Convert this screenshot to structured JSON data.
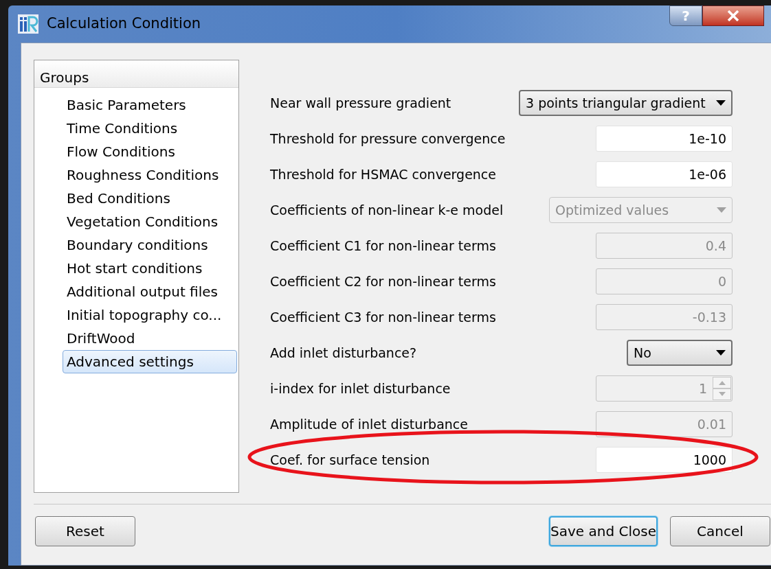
{
  "window": {
    "title": "Calculation Condition",
    "help": "?"
  },
  "groups": {
    "header": "Groups",
    "items": [
      {
        "label": "Basic Parameters",
        "selected": false
      },
      {
        "label": "Time Conditions",
        "selected": false
      },
      {
        "label": "Flow Conditions",
        "selected": false
      },
      {
        "label": "Roughness Conditions",
        "selected": false
      },
      {
        "label": "Bed Conditions",
        "selected": false
      },
      {
        "label": "Vegetation Conditions",
        "selected": false
      },
      {
        "label": "Boundary conditions",
        "selected": false
      },
      {
        "label": "Hot start conditions",
        "selected": false
      },
      {
        "label": "Additional output files",
        "selected": false
      },
      {
        "label": "Initial topography co...",
        "selected": false
      },
      {
        "label": "DriftWood",
        "selected": false
      },
      {
        "label": "Advanced settings",
        "selected": true
      }
    ]
  },
  "settings": [
    {
      "label": "Near wall pressure gradient",
      "kind": "combo",
      "value": "3 points triangular gradient",
      "disabled": false
    },
    {
      "label": "Threshold for pressure convergence",
      "kind": "input",
      "value": "1e-10",
      "disabled": false
    },
    {
      "label": "Threshold for HSMAC convergence",
      "kind": "input",
      "value": "1e-06",
      "disabled": false
    },
    {
      "label": "Coefficients of non-linear k-e model",
      "kind": "combo",
      "value": "Optimized values",
      "disabled": true
    },
    {
      "label": "Coefficient C1 for non-linear terms",
      "kind": "input",
      "value": "0.4",
      "disabled": true
    },
    {
      "label": "Coefficient C2 for non-linear terms",
      "kind": "input",
      "value": "0",
      "disabled": true
    },
    {
      "label": "Coefficient C3 for non-linear terms",
      "kind": "input",
      "value": "-0.13",
      "disabled": true
    },
    {
      "label": "Add inlet disturbance?",
      "kind": "combo",
      "value": "No",
      "disabled": false
    },
    {
      "label": "i-index for inlet disturbance",
      "kind": "spin",
      "value": "1",
      "disabled": true
    },
    {
      "label": "Amplitude of inlet disturbance",
      "kind": "input",
      "value": "0.01",
      "disabled": true
    },
    {
      "label": "Coef. for surface tension",
      "kind": "input",
      "value": "1000",
      "disabled": false
    }
  ],
  "buttons": [
    {
      "label": "Reset",
      "focused": false
    },
    {
      "label": "Save and Close",
      "focused": true
    },
    {
      "label": "Cancel",
      "focused": false
    }
  ]
}
